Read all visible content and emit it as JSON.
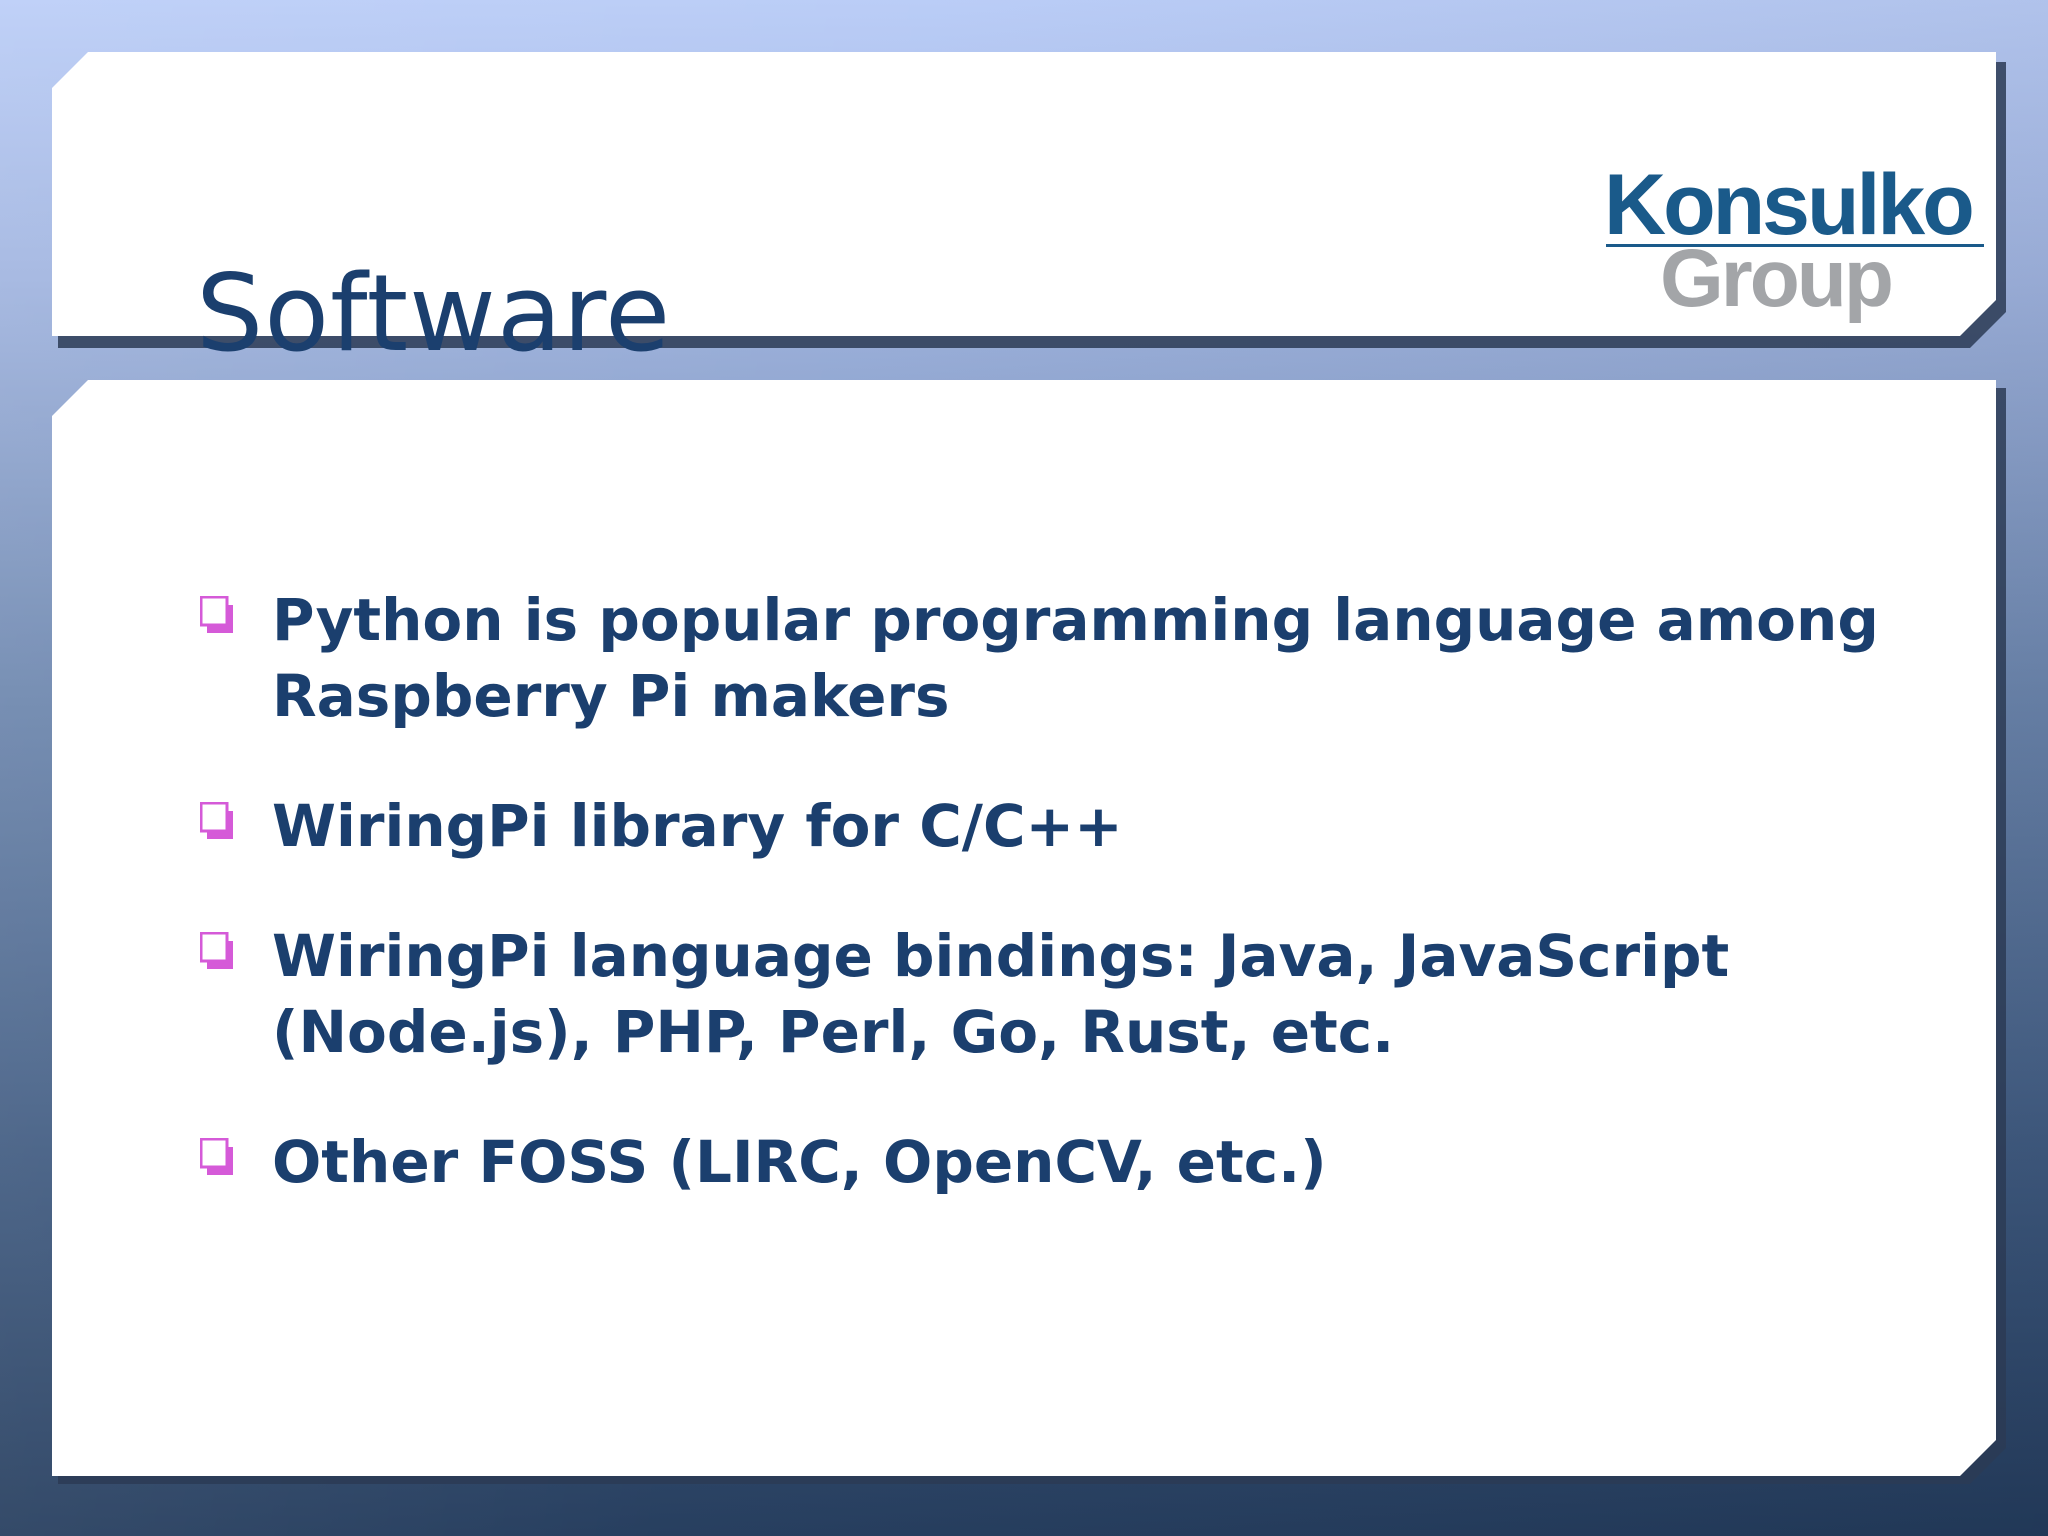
{
  "slide": {
    "title": "Software",
    "logo": {
      "line1": "Konsulko",
      "line2": "Group"
    },
    "bullets": [
      {
        "text": "Python is popular programming language among Raspberry Pi makers"
      },
      {
        "text": "WiringPi library for C/C++"
      },
      {
        "text": "WiringPi language bindings: Java, JavaScript (Node.js), PHP, Perl, Go, Rust, etc."
      },
      {
        "text": "Other FOSS (LIRC, OpenCV, etc.)"
      }
    ],
    "bullet_icon": "square-checkbox-bullet-icon"
  },
  "colors": {
    "title_text": "#1b3f6e",
    "bullet_text": "#1b3f6e",
    "bullet_marker": "#d55ad8",
    "logo_blue": "#1a5a8a",
    "logo_gray": "#a3a5a8",
    "panel_fill": "#ffffff"
  }
}
